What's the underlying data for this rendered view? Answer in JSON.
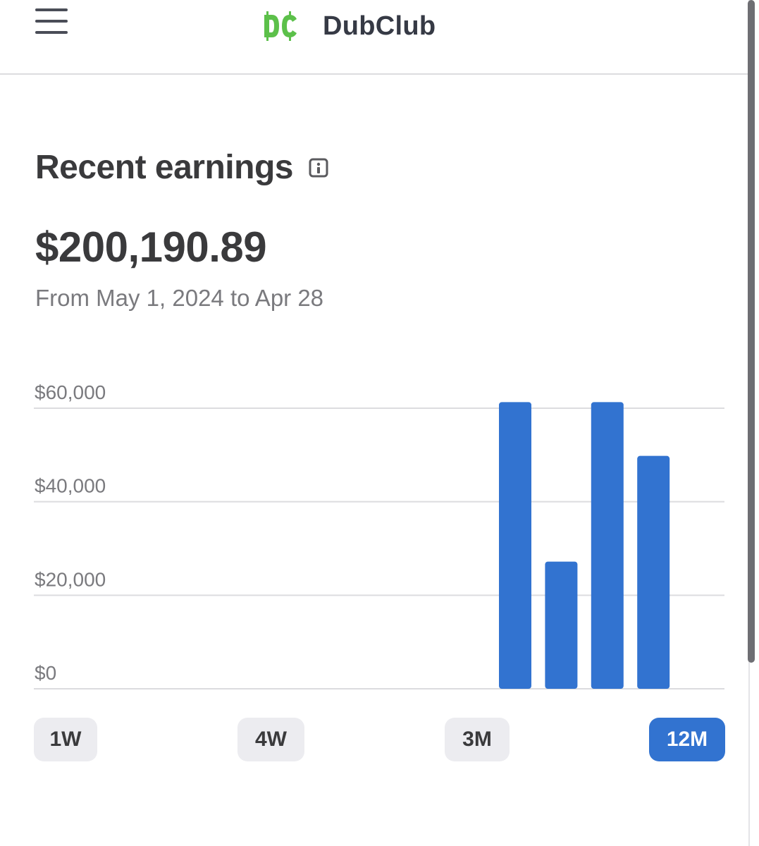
{
  "header": {
    "brand_name": "DubClub",
    "logo_text": "DC",
    "logo_color": "#5cc04a"
  },
  "earnings": {
    "title": "Recent earnings",
    "total": "$200,190.89",
    "date_range": "From May 1, 2024 to Apr 28"
  },
  "colors": {
    "accent": "#3273d0",
    "button_bg": "#ececf0",
    "text_dark": "#3a3a3c",
    "text_muted": "#7a7a7e"
  },
  "chart_data": {
    "type": "bar",
    "ylim": [
      0,
      60000
    ],
    "y_ticks": [
      0,
      20000,
      40000,
      60000
    ],
    "y_tick_labels": [
      "$0",
      "$20,000",
      "$40,000",
      "$60,000"
    ],
    "values": [
      0,
      0,
      0,
      0,
      0,
      0,
      0,
      0,
      0,
      0,
      61300,
      27200,
      61300,
      49800
    ],
    "bar_color": "#3273d0",
    "grid": true
  },
  "range_buttons": [
    {
      "label": "1W",
      "active": false
    },
    {
      "label": "4W",
      "active": false
    },
    {
      "label": "3M",
      "active": false
    },
    {
      "label": "12M",
      "active": true
    }
  ]
}
